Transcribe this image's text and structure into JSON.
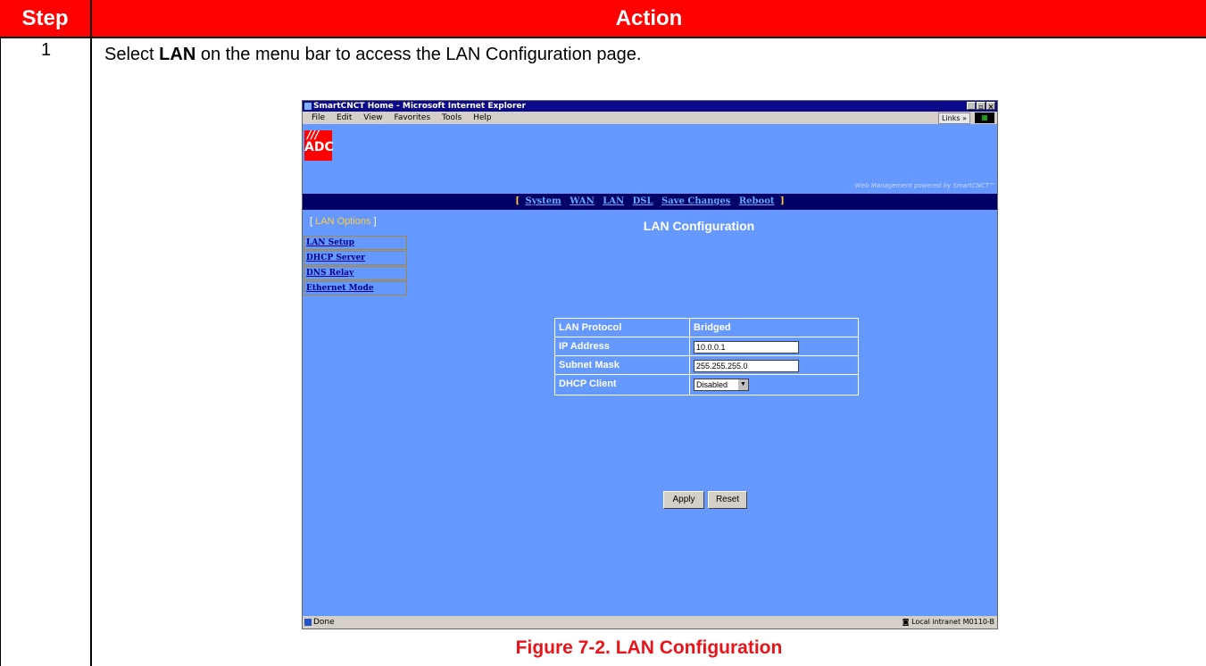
{
  "table": {
    "header_step": "Step",
    "header_action": "Action",
    "step_number": "1",
    "instruction_before": "Select ",
    "instruction_bold": "LAN",
    "instruction_after": " on the menu bar to access the LAN Configuration page.",
    "caption": "Figure 7-2. LAN Configuration",
    "header_color": "#ff0000",
    "caption_color": "#e8141a"
  },
  "browser": {
    "title": "SmartCNCT Home - Microsoft Internet Explorer",
    "menu": [
      "File",
      "Edit",
      "View",
      "Favorites",
      "Tools",
      "Help"
    ],
    "links_label": "Links »",
    "status": "Done",
    "zone": "Local intranet",
    "figure_id": "M0110-B",
    "background_color": "#6699ff"
  },
  "app": {
    "logo_text": "ADC",
    "powered_by": "Web Management powered by SmartCNCT™",
    "nav": [
      "System",
      "WAN",
      "LAN",
      "DSL",
      "Save Changes",
      "Reboot"
    ],
    "side_title": "LAN Options",
    "side_items": [
      "LAN Setup",
      "DHCP Server",
      "DNS Relay",
      "Ethernet Mode"
    ],
    "page_title": "LAN Configuration",
    "form": {
      "lan_protocol_label": "LAN Protocol",
      "lan_protocol_value": "Bridged",
      "ip_label": "IP Address",
      "ip_value": "10.0.0.1",
      "subnet_label": "Subnet Mask",
      "subnet_value": "255.255.255.0",
      "dhcp_label": "DHCP Client",
      "dhcp_value": "Disabled"
    },
    "apply_label": "Apply",
    "reset_label": "Reset"
  }
}
